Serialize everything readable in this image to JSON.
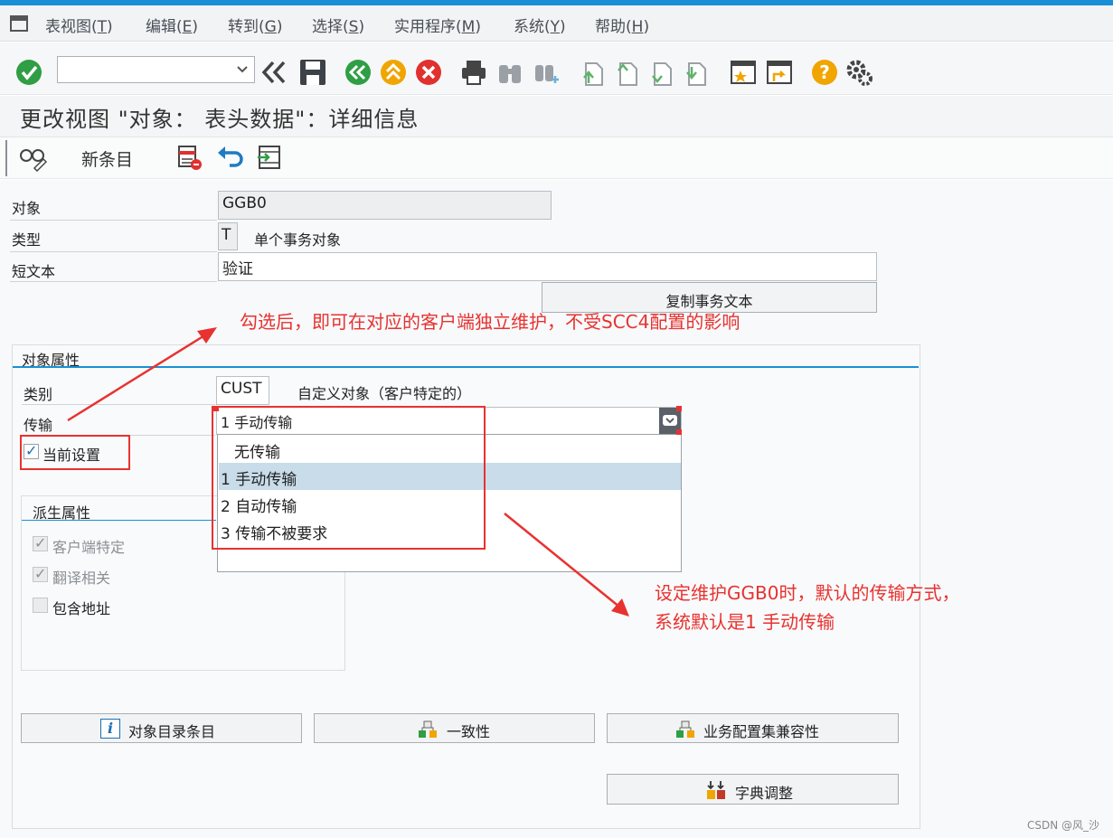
{
  "menu": [
    {
      "label": "表视图(",
      "key": "T",
      "end": ")"
    },
    {
      "label": "编辑(",
      "key": "E",
      "end": ")"
    },
    {
      "label": "转到(",
      "key": "G",
      "end": ")"
    },
    {
      "label": "选择(",
      "key": "S",
      "end": ")"
    },
    {
      "label": "实用程序(",
      "key": "M",
      "end": ")"
    },
    {
      "label": "系统(",
      "key": "Y",
      "end": ")"
    },
    {
      "label": "帮助(",
      "key": "H",
      "end": ")"
    }
  ],
  "command_field": {
    "value": ""
  },
  "page_title": "更改视图 \"对象： 表头数据\"：详细信息",
  "app_toolbar": {
    "new_entries_label": "新条目"
  },
  "fields": {
    "object_label": "对象",
    "object_value": "GGB0",
    "type_label": "类型",
    "type_value": "T",
    "type_desc": "单个事务对象",
    "short_text_label": "短文本",
    "short_text_value": "验证",
    "copy_text_button": "复制事务文本"
  },
  "object_attributes": {
    "title": "对象属性",
    "category_label": "类别",
    "category_value": "CUST",
    "category_desc": "自定义对象（客户特定的）",
    "transport_label": "传输",
    "transport_value": "1 手动传输",
    "current_settings_label": "当前设置",
    "current_settings_checked": true
  },
  "dropdown_options": [
    {
      "label": "无传输",
      "selected": false
    },
    {
      "label": "1 手动传输",
      "selected": true
    },
    {
      "label": "2 自动传输",
      "selected": false
    },
    {
      "label": "3 传输不被要求",
      "selected": false
    }
  ],
  "derived_attributes": {
    "title": "派生属性",
    "client_specific_label": "客户端特定",
    "client_specific_checked": true,
    "translation_label": "翻译相关",
    "translation_checked": true,
    "contains_address_label": "包含地址",
    "contains_address_checked": false
  },
  "bottom_buttons": {
    "object_dir": "对象目录条目",
    "consistency": "一致性",
    "bc_set_compat": "业务配置集兼容性",
    "dict_adjust": "字典调整"
  },
  "annotations": {
    "arrow_note_1": "勾选后，即可在对应的客户端独立维护，不受SCC4配置的影响",
    "arrow_note_2_line1": "设定维护GGB0时，默认的传输方式，",
    "arrow_note_2_line2": "系统默认是1 手动传输"
  },
  "watermark": "CSDN @风_沙",
  "colors": {
    "accent": "#1a8fd6",
    "annotation_red": "#e8322f",
    "selection_blue": "#c8dcea"
  }
}
